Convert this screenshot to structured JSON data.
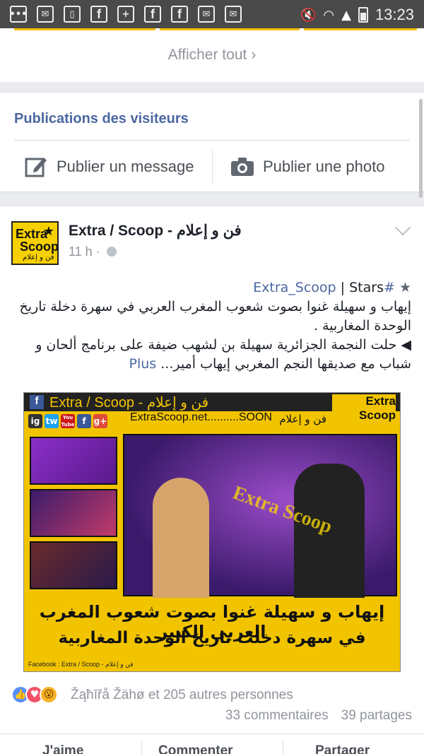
{
  "status_bar": {
    "time": "13:23"
  },
  "top_card": {
    "show_all_label": "Afficher tout",
    "show_all_chevron": "›"
  },
  "visitors": {
    "title": "Publications des visiteurs",
    "post_message_label": "Publier un message",
    "post_photo_label": "Publier une photo"
  },
  "post": {
    "page_name": "Extra / Scoop - فن و إعلام",
    "avatar": {
      "line1": "Extra",
      "line2": "Scoop",
      "line3": "فن و إعلام",
      "star": "★"
    },
    "time": "11 h",
    "time_sep": "·",
    "text": {
      "hashtag": "#Extra_Scoop",
      "stars": "Stars",
      "sep": "|",
      "star_glyph": "★",
      "line2": "إيهاب و سهيلة غنوا بصوت شعوب المغرب العربي في سهرة دخلة تاريخ الوحدة المغاربية .",
      "line3": "◀ حلت النجمة الجزائرية سهيلة بن لشهب ضيفة على برنامج ألحان و شباب مع صديقها النجم المغربي إيهاب أمير...",
      "plus": "Plus"
    },
    "image": {
      "header_title": "Extra / Scoop - فن و إعلام",
      "fb_glyph": "f",
      "logo_line1": "Extra",
      "logo_line2": "Scoop",
      "logo_arabic": "فن و إعلام",
      "site": "ExtraScoop.net..........SOON",
      "social": [
        "ig",
        "tw",
        "You Tube",
        "f",
        "g+"
      ],
      "watermark": "Extra Scoop",
      "caption_line1": "إيهاب و سهيلة غنوا بصوت شعوب المغرب العربي الكبير",
      "caption_line2": "في سهرة دخلت تاريخ الوحدة المغاربية",
      "footer": "Facebook : Extra / Scoop - فن و إعلام"
    },
    "reactions": {
      "icons": [
        "like",
        "love",
        "wow"
      ],
      "like_glyph": "👍",
      "love_glyph": "♥",
      "wow_glyph": "😮",
      "text": "Žąħīřå Žähø et 205 autres personnes"
    },
    "comments": "33 commentaires",
    "shares": "39 partages",
    "actions": {
      "like": "J'aime",
      "comment": "Commenter",
      "share": "Partager"
    }
  }
}
